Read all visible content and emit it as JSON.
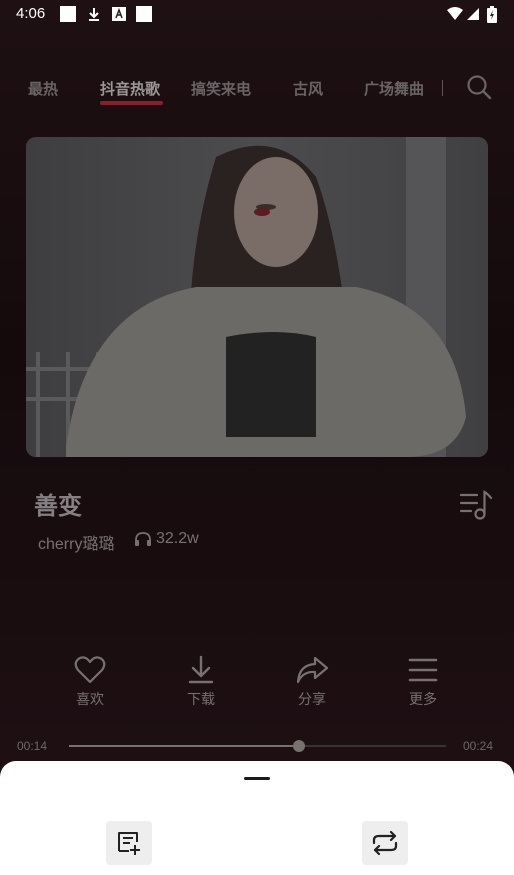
{
  "status_bar": {
    "time": "4:06",
    "icons": [
      "notification-square-icon",
      "download-icon",
      "font-a-icon",
      "notification-square-icon",
      "wifi-icon",
      "signal-icon",
      "battery-icon"
    ]
  },
  "tabs": {
    "items": [
      {
        "label": "最热",
        "active": false
      },
      {
        "label": "抖音热歌",
        "active": true
      },
      {
        "label": "搞笑来电",
        "active": false
      },
      {
        "label": "古风",
        "active": false
      },
      {
        "label": "广场舞曲",
        "active": false
      }
    ],
    "accent": "#8a1f2b"
  },
  "song": {
    "title": "善变",
    "artist": "cherry璐璐",
    "plays": "32.2w"
  },
  "actions": [
    {
      "label": "喜欢",
      "icon": "heart-icon"
    },
    {
      "label": "下载",
      "icon": "download-icon"
    },
    {
      "label": "分享",
      "icon": "share-icon"
    },
    {
      "label": "更多",
      "icon": "menu-icon"
    }
  ],
  "progress": {
    "current": "00:14",
    "total": "00:24",
    "fraction": 0.61
  },
  "sheet": {
    "buttons": [
      {
        "icon": "playlist-add-icon"
      },
      {
        "icon": "repeat-icon"
      }
    ]
  }
}
